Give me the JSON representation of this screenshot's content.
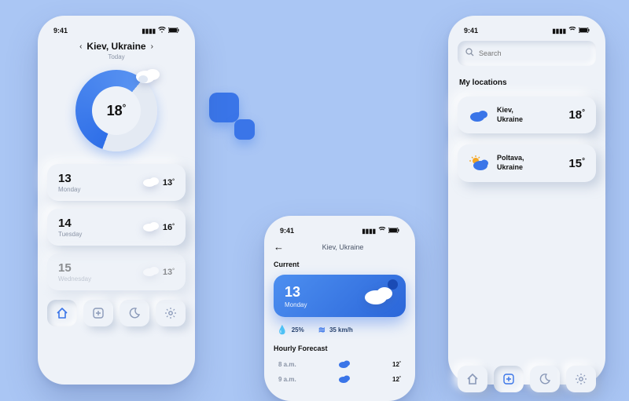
{
  "status": {
    "time": "9:41"
  },
  "phone1": {
    "location": "Kiev, Ukraine",
    "subtitle": "Today",
    "ring_temp": "18",
    "days": [
      {
        "num": "13",
        "name": "Monday",
        "temp": "13"
      },
      {
        "num": "14",
        "name": "Tuesday",
        "temp": "16"
      },
      {
        "num": "15",
        "name": "Wednesday",
        "temp": "13"
      }
    ],
    "tabs": [
      "home",
      "add",
      "moon",
      "settings"
    ]
  },
  "phone2": {
    "location": "Kiev, Ukraine",
    "current_label": "Current",
    "current": {
      "num": "13",
      "day": "Monday"
    },
    "humidity": "25%",
    "wind": "35 km/h",
    "hourly_label": "Hourly Forecast",
    "hourly": [
      {
        "time": "8  a.m.",
        "temp": "12"
      },
      {
        "time": "9  a.m.",
        "temp": "12"
      }
    ]
  },
  "phone3": {
    "search_placeholder": "Search",
    "section_title": "My locations",
    "locations": [
      {
        "city": "Kiev,",
        "country": "Ukraine",
        "temp": "18",
        "icon": "cloud"
      },
      {
        "city": "Poltava,",
        "country": "Ukraine",
        "temp": "15",
        "icon": "sun-cloud"
      }
    ],
    "tabs": [
      "home",
      "add",
      "moon",
      "settings"
    ]
  }
}
